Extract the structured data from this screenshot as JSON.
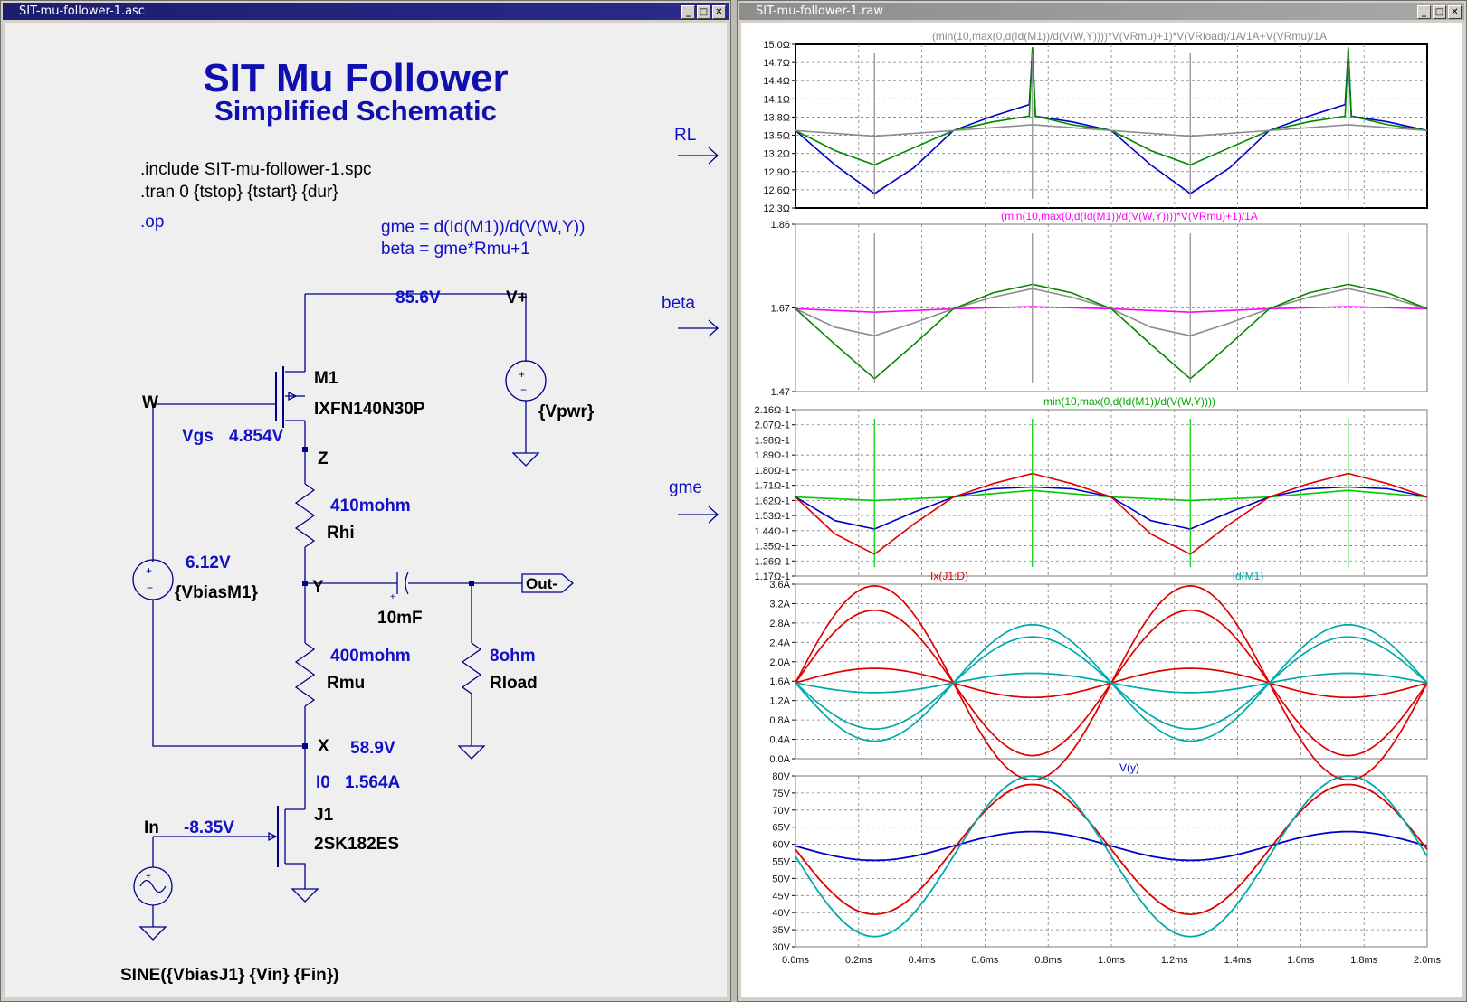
{
  "schematic_window": {
    "title": "SIT-mu-follower-1.asc",
    "controls": [
      "_",
      "□",
      "✕"
    ]
  },
  "waveform_window": {
    "title": "SIT-mu-follower-1.raw",
    "controls": [
      "_",
      "□",
      "✕"
    ]
  },
  "schematic": {
    "title": "SIT Mu Follower",
    "subtitle": "Simplified Schematic",
    "directives": [
      ".include SIT-mu-follower-1.spc",
      ".tran 0 {tstop} {tstart} {dur}"
    ],
    "op_directive": ".op",
    "params": [
      "gme = d(Id(M1))/d(V(W,Y))",
      "beta = gme*Rmu+1"
    ],
    "arrow_labels": {
      "rl": "RL",
      "beta": "beta",
      "gme": "gme"
    },
    "net_labels": {
      "vplus": "V+",
      "w": "W",
      "z": "Z",
      "y": "Y",
      "x": "X",
      "in": "In",
      "out": "Out-"
    },
    "op_values": {
      "top_voltage": "85.6V",
      "vgs_label": "Vgs",
      "vgs": "4.854V",
      "vbias_m1": "6.12V",
      "x_voltage": "58.9V",
      "i0_label": "I0",
      "i0": "1.564A",
      "in_voltage": "-8.35V"
    },
    "components": {
      "m1_name": "M1",
      "m1_model": "IXFN140N30P",
      "vpwr": "{Vpwr}",
      "rhi_value": "410mohm",
      "rhi_name": "Rhi",
      "vbiasm1": "{VbiasM1}",
      "cap_value": "10mF",
      "rmu_value": "400mohm",
      "rmu_name": "Rmu",
      "rload_value": "8ohm",
      "rload_name": "Rload",
      "j1_name": "J1",
      "j1_model": "2SK182ES",
      "source": "SINE({VbiasJ1} {Vin} {Fin})"
    }
  },
  "x_axis": {
    "ticks": [
      "0.0ms",
      "0.2ms",
      "0.4ms",
      "0.6ms",
      "0.8ms",
      "1.0ms",
      "1.2ms",
      "1.4ms",
      "1.6ms",
      "1.8ms",
      "2.0ms"
    ]
  },
  "panes": [
    {
      "title": "(min(10,max(0,d(Id(M1))/d(V(W,Y))))*V(VRmu)+1)*V(VRload)/1A/1A+V(VRmu)/1A",
      "title_color": "#8c8c8c",
      "yticks": [
        "15.0Ω",
        "14.7Ω",
        "14.4Ω",
        "14.1Ω",
        "13.8Ω",
        "13.5Ω",
        "13.2Ω",
        "12.9Ω",
        "12.6Ω",
        "12.3Ω"
      ],
      "ylim": [
        12.3,
        15.15
      ]
    },
    {
      "title": "(min(10,max(0,d(Id(M1))/d(V(W,Y))))*V(VRmu)+1)/1A",
      "title_color": "#ff00ff",
      "yticks": [
        "1.86",
        "1.67",
        "1.47"
      ],
      "ylim": [
        1.47,
        1.86
      ]
    },
    {
      "title": "min(10,max(0,d(Id(M1))/d(V(W,Y))))",
      "title_color": "#00aa00",
      "yticks": [
        "2.16Ω-1",
        "2.07Ω-1",
        "1.98Ω-1",
        "1.89Ω-1",
        "1.80Ω-1",
        "1.71Ω-1",
        "1.62Ω-1",
        "1.53Ω-1",
        "1.44Ω-1",
        "1.35Ω-1",
        "1.26Ω-1",
        "1.17Ω-1"
      ],
      "ylim": [
        1.17,
        2.16
      ]
    },
    {
      "titles": [
        "Ix(J1:D)",
        "Id(M1)"
      ],
      "title_colors": [
        "#e00000",
        "#00aaaa"
      ],
      "yticks": [
        "3.6A",
        "3.2A",
        "2.8A",
        "2.4A",
        "2.0A",
        "1.6A",
        "1.2A",
        "0.8A",
        "0.4A",
        "0.0A"
      ],
      "ylim": [
        0.0,
        3.6
      ]
    },
    {
      "title": "V(y)",
      "title_color": "#0000cc",
      "yticks": [
        "80V",
        "75V",
        "70V",
        "65V",
        "60V",
        "55V",
        "50V",
        "45V",
        "40V",
        "35V",
        "30V"
      ],
      "ylim": [
        30,
        80
      ]
    }
  ],
  "chart_data": [
    {
      "type": "line",
      "x_unit": "ms",
      "ylim": [
        12.3,
        15.15
      ],
      "series": [
        {
          "color": "#0000cc",
          "x": [
            0,
            0.125,
            0.25,
            0.375,
            0.5,
            0.625,
            0.74,
            0.75,
            0.76,
            0.875,
            1.0,
            1.125,
            1.25,
            1.375,
            1.5,
            1.625,
            1.74,
            1.75,
            1.76,
            1.875,
            2.0
          ],
          "y": [
            13.65,
            13.05,
            12.55,
            13.0,
            13.65,
            13.9,
            14.1,
            15.05,
            13.9,
            13.8,
            13.65,
            13.05,
            12.55,
            13.0,
            13.65,
            13.9,
            14.1,
            15.05,
            13.9,
            13.8,
            13.65
          ]
        },
        {
          "color": "#008800",
          "x": [
            0,
            0.125,
            0.25,
            0.375,
            0.5,
            0.625,
            0.74,
            0.75,
            0.76,
            0.875,
            1.0,
            1.125,
            1.25,
            1.375,
            1.5,
            1.625,
            1.74,
            1.75,
            1.76,
            1.875,
            2.0
          ],
          "y": [
            13.65,
            13.3,
            13.05,
            13.35,
            13.65,
            13.8,
            13.9,
            15.1,
            13.9,
            13.75,
            13.65,
            13.3,
            13.05,
            13.35,
            13.65,
            13.8,
            13.9,
            15.1,
            13.9,
            13.75,
            13.65
          ]
        },
        {
          "color": "#8c8c8c",
          "x": [
            0,
            0.25,
            0.5,
            0.75,
            1.0,
            1.25,
            1.5,
            1.75,
            2.0
          ],
          "y": [
            13.65,
            13.55,
            13.65,
            13.75,
            13.65,
            13.55,
            13.65,
            13.75,
            13.65
          ]
        }
      ]
    },
    {
      "type": "line",
      "x_unit": "ms",
      "ylim": [
        1.47,
        1.86
      ],
      "series": [
        {
          "color": "#ff00ff",
          "x": [
            0,
            0.25,
            0.5,
            0.75,
            1.0,
            1.25,
            1.5,
            1.75,
            2.0
          ],
          "y": [
            1.663,
            1.655,
            1.663,
            1.668,
            1.663,
            1.655,
            1.663,
            1.668,
            1.663
          ]
        },
        {
          "color": "#8c8c8c",
          "x": [
            0,
            0.125,
            0.25,
            0.375,
            0.5,
            0.625,
            0.75,
            0.875,
            1.0,
            1.125,
            1.25,
            1.375,
            1.5,
            1.625,
            1.75,
            1.875,
            2.0
          ],
          "y": [
            1.663,
            1.62,
            1.6,
            1.63,
            1.663,
            1.69,
            1.71,
            1.69,
            1.663,
            1.62,
            1.6,
            1.63,
            1.663,
            1.69,
            1.71,
            1.69,
            1.663
          ]
        },
        {
          "color": "#008800",
          "x": [
            0,
            0.125,
            0.25,
            0.375,
            0.5,
            0.625,
            0.75,
            0.875,
            1.0,
            1.125,
            1.25,
            1.375,
            1.5,
            1.625,
            1.75,
            1.875,
            2.0
          ],
          "y": [
            1.663,
            1.58,
            1.5,
            1.58,
            1.663,
            1.7,
            1.72,
            1.7,
            1.663,
            1.58,
            1.5,
            1.58,
            1.663,
            1.7,
            1.72,
            1.7,
            1.663
          ]
        }
      ]
    },
    {
      "type": "line",
      "x_unit": "ms",
      "ylim": [
        1.17,
        2.16
      ],
      "series": [
        {
          "color": "#00cc00",
          "x": [
            0,
            0.25,
            0.5,
            0.75,
            1.0,
            1.25,
            1.5,
            1.75,
            2.0
          ],
          "y": [
            1.64,
            1.62,
            1.64,
            1.68,
            1.64,
            1.62,
            1.64,
            1.68,
            1.64
          ]
        },
        {
          "color": "#0000cc",
          "x": [
            0,
            0.125,
            0.25,
            0.375,
            0.5,
            0.625,
            0.75,
            0.875,
            1.0,
            1.125,
            1.25,
            1.375,
            1.5,
            1.625,
            1.75,
            1.875,
            2.0
          ],
          "y": [
            1.64,
            1.5,
            1.45,
            1.55,
            1.64,
            1.69,
            1.7,
            1.69,
            1.64,
            1.5,
            1.45,
            1.55,
            1.64,
            1.69,
            1.7,
            1.69,
            1.64
          ]
        },
        {
          "color": "#e00000",
          "x": [
            0,
            0.125,
            0.25,
            0.375,
            0.5,
            0.625,
            0.75,
            0.875,
            1.0,
            1.125,
            1.25,
            1.375,
            1.5,
            1.625,
            1.75,
            1.875,
            2.0
          ],
          "y": [
            1.64,
            1.42,
            1.3,
            1.48,
            1.64,
            1.72,
            1.78,
            1.72,
            1.64,
            1.42,
            1.3,
            1.48,
            1.64,
            1.72,
            1.78,
            1.72,
            1.64
          ]
        }
      ]
    },
    {
      "type": "line",
      "x_unit": "ms",
      "ylim": [
        0.0,
        3.6
      ],
      "series": [
        {
          "name": "Ix(J1:D)",
          "color": "#e00000",
          "amplitudes_A": [
            2.0,
            1.5,
            0.3
          ],
          "center_A": 1.564
        },
        {
          "name": "Id(M1)",
          "color": "#00aaaa",
          "amplitudes_A": [
            1.2,
            0.95,
            0.2
          ],
          "center_A": 1.564
        }
      ]
    },
    {
      "type": "line",
      "x_unit": "ms",
      "ylim": [
        30,
        80
      ],
      "series": [
        {
          "color": "#0000cc",
          "center_V": 59.5,
          "amplitude_V": 4.2
        },
        {
          "color": "#e00000",
          "center_V": 58.5,
          "amplitude_V": 19
        },
        {
          "color": "#00aaaa",
          "center_V": 56.5,
          "amplitude_V": 23.5
        }
      ]
    }
  ]
}
